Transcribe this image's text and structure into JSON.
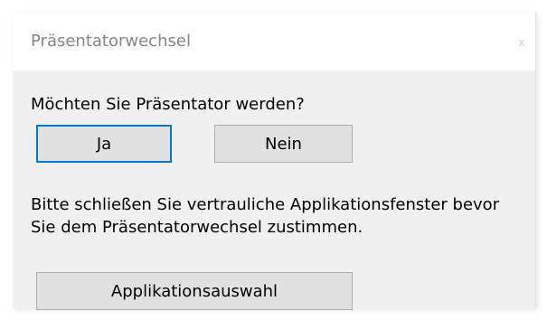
{
  "dialog": {
    "title": "Präsentatorwechsel",
    "close_label": "x",
    "question": "Möchten Sie Präsentator werden?",
    "yes_label": "Ja",
    "no_label": "Nein",
    "info_line1": "Bitte schließen Sie vertrauliche Applikationsfenster bevor",
    "info_line2": "Sie dem Präsentatorwechsel zustimmen.",
    "apps_label": "Applikationsauswahl"
  },
  "colors": {
    "focus_accent": "#0078d7",
    "dialog_background": "#f0f0f0",
    "button_background": "#e1e1e1"
  }
}
